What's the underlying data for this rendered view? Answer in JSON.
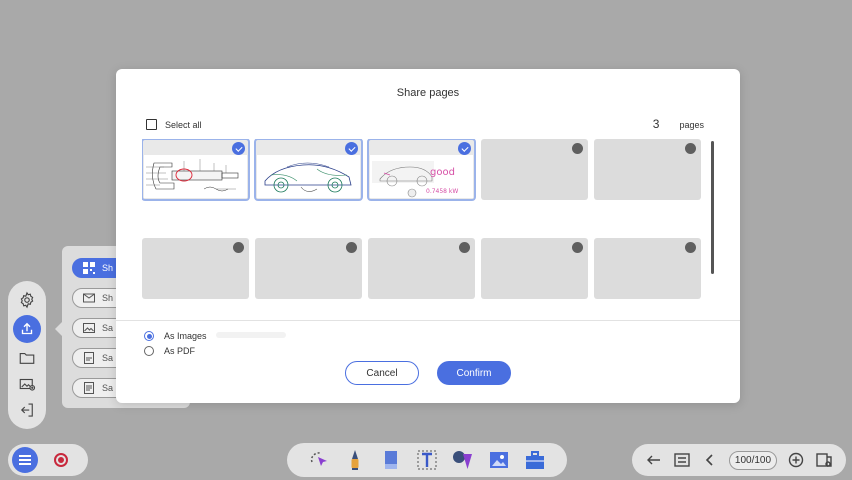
{
  "background_app": {
    "left_rail": {
      "items": [
        {
          "name": "settings",
          "icon": "gear-icon"
        },
        {
          "name": "share",
          "icon": "upload-icon"
        },
        {
          "name": "open",
          "icon": "folder-icon"
        },
        {
          "name": "insert-image",
          "icon": "image-add-icon"
        },
        {
          "name": "exit",
          "icon": "exit-icon"
        }
      ]
    },
    "share_submenu": {
      "items": [
        {
          "label": "Sh",
          "icon": "qr-code-icon"
        },
        {
          "label": "Sh",
          "icon": "mail-icon"
        },
        {
          "label": "Sa",
          "icon": "image-icon"
        },
        {
          "label": "Sa",
          "icon": "pdf-icon"
        },
        {
          "label": "Sa",
          "icon": "doc-icon"
        }
      ]
    },
    "bottom_right": {
      "page_counter": "100/100"
    }
  },
  "dialog": {
    "title": "Share pages",
    "select_all_label": "Select all",
    "selected_count": "3",
    "count_unit": "pages",
    "thumbnails": [
      {
        "index": 1,
        "selected": true,
        "content": "micrometer diagram"
      },
      {
        "index": 2,
        "selected": true,
        "content": "car sketch"
      },
      {
        "index": 3,
        "selected": true,
        "content": "car drawing",
        "annotation_text": "good",
        "annotation_value": "0.7458 kW"
      },
      {
        "index": 4,
        "selected": false
      },
      {
        "index": 5,
        "selected": false
      },
      {
        "index": 6,
        "selected": false
      },
      {
        "index": 7,
        "selected": false
      },
      {
        "index": 8,
        "selected": false
      },
      {
        "index": 9,
        "selected": false
      },
      {
        "index": 10,
        "selected": false
      }
    ],
    "format_options": [
      {
        "label": "As Images",
        "selected": true
      },
      {
        "label": "As PDF",
        "selected": false
      }
    ],
    "cancel_label": "Cancel",
    "confirm_label": "Confirm"
  },
  "colors": {
    "accent": "#4a6fe0",
    "overlay": "#a9a9a9",
    "record": "#c8283c",
    "annotation": "#d64fa6"
  }
}
